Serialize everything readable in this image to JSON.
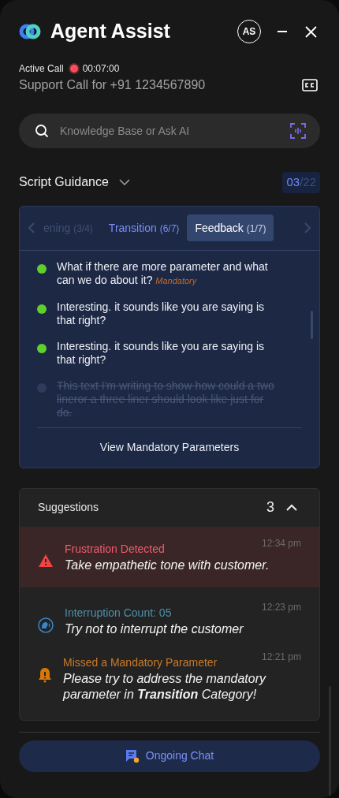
{
  "header": {
    "title": "Agent Assist",
    "avatar": "AS"
  },
  "call": {
    "status": "Active Call",
    "recording": true,
    "timer": "00:07:00",
    "subtitle": "Support Call for +91 1234567890"
  },
  "search": {
    "placeholder": "Knowledge Base or Ask AI"
  },
  "script_guidance": {
    "title": "Script Guidance",
    "expanded": false,
    "counter_current": "03",
    "counter_rest": "/22",
    "tabs": [
      {
        "label": "ening",
        "count": "(3/4)",
        "selected": false,
        "faded": true
      },
      {
        "label": "Transition",
        "count": "(6/7)",
        "selected": false,
        "faded": false
      },
      {
        "label": "Feedback",
        "count": "(1/7)",
        "selected": true,
        "faded": false
      }
    ],
    "items": [
      {
        "text": "What if there are more parameter and what can we do about it?",
        "tag": "Mandatory",
        "done": false
      },
      {
        "text": "Interesting. it sounds like you are saying is that right?",
        "done": false
      },
      {
        "text": "Interesting. it sounds like you are saying is that right?",
        "done": false
      },
      {
        "text": "This text I'm writing to show how could a two lineror a three liner should look like just for do.",
        "done": true
      }
    ],
    "footer_button": "View Mandatory Parameters"
  },
  "suggestions": {
    "title": "Suggestions",
    "count": "3",
    "expanded": true,
    "items": [
      {
        "kind": "frustration",
        "title": "Frustration Detected",
        "time": "12:34 pm",
        "message": "Take empathetic tone with customer."
      },
      {
        "kind": "interruption",
        "title": "Interruption Count: 05",
        "time": "12:23 pm",
        "message": "Try not to interrupt the customer"
      },
      {
        "kind": "missed",
        "title": "Missed a Mandatory Parameter",
        "time": "12:21 pm",
        "message": "Please try to address the mandatory parameter in **Transition** Category!"
      }
    ]
  },
  "bottom_button": {
    "label": "Ongoing Chat"
  }
}
